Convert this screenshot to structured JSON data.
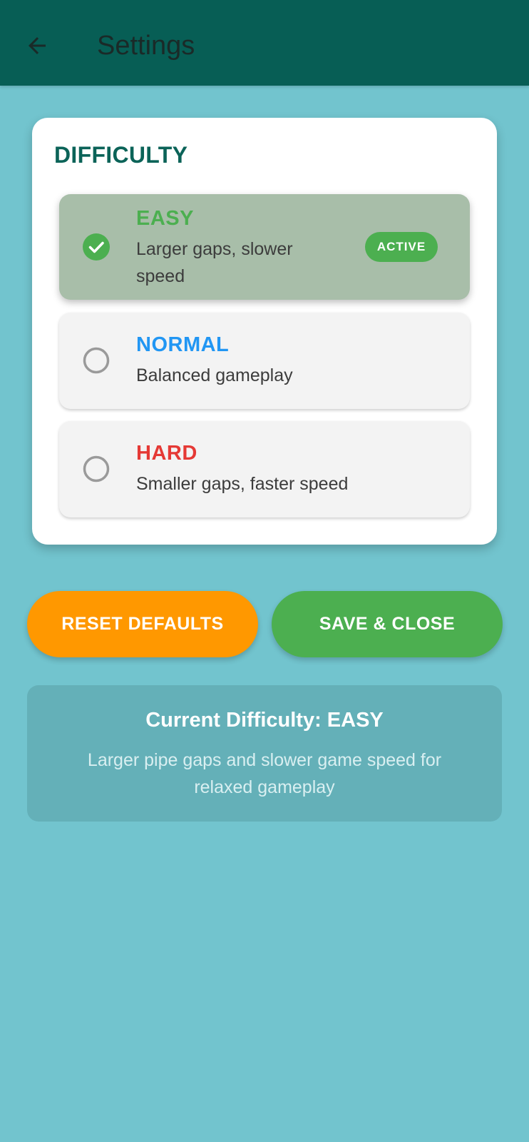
{
  "app_bar": {
    "title": "Settings",
    "back_icon": "arrow-left-icon",
    "background": "#075e55"
  },
  "difficulty": {
    "section_title": "DIFFICULTY",
    "selected": "EASY",
    "options": [
      {
        "name": "EASY",
        "description": "Larger gaps, slower speed",
        "color": "#4caf50",
        "selected": true,
        "badge": "ACTIVE"
      },
      {
        "name": "NORMAL",
        "description": "Balanced gameplay",
        "color": "#2196f3",
        "selected": false
      },
      {
        "name": "HARD",
        "description": "Smaller gaps, faster speed",
        "color": "#e53935",
        "selected": false
      }
    ]
  },
  "buttons": {
    "reset_label": "RESET DEFAULTS",
    "reset_color": "#ff9800",
    "save_label": "SAVE & CLOSE",
    "save_color": "#4caf50"
  },
  "info": {
    "title": "Current Difficulty: EASY",
    "description": "Larger pipe gaps and slower game speed for relaxed gameplay"
  }
}
